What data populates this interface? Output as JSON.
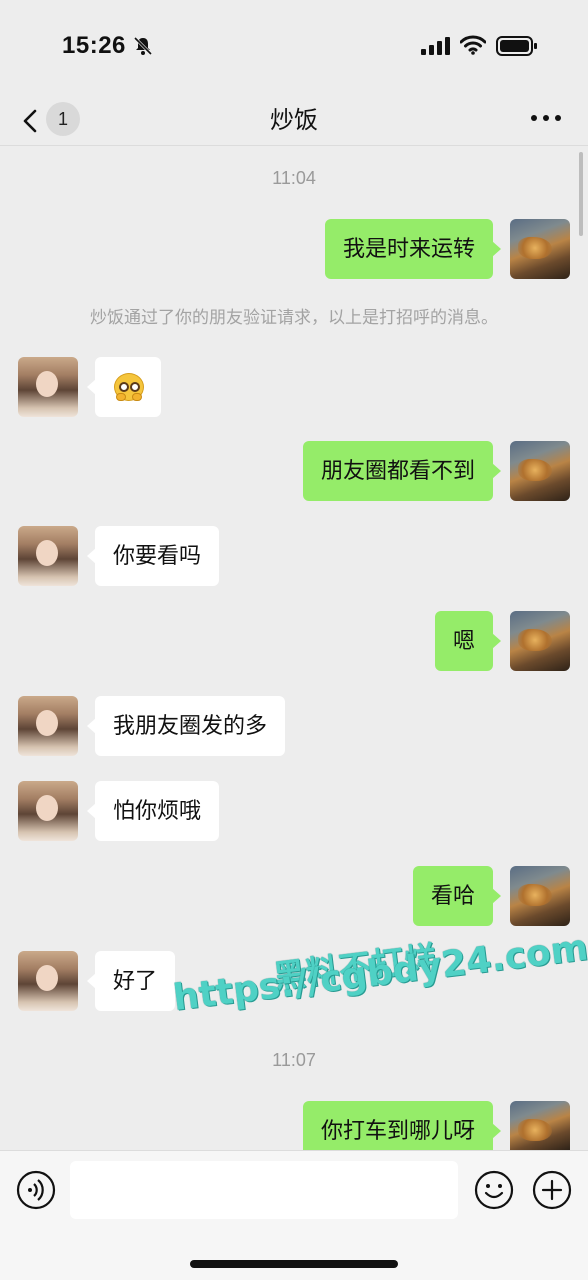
{
  "status_bar": {
    "time": "15:26",
    "icons": [
      "bell-muted-icon",
      "cellular-signal-icon",
      "wifi-icon",
      "battery-icon"
    ]
  },
  "nav": {
    "unread_count": "1",
    "title": "炒饭",
    "back_icon": "chevron-left-icon",
    "more_icon": "more-dots-icon"
  },
  "messages": {
    "time1": "11:04",
    "m1": "我是时来运转",
    "system": "炒饭通过了你的朋友验证请求，以上是打招呼的消息。",
    "m2_emoji": "pleading-face-emoji",
    "m3": "朋友圈都看不到",
    "m4": "你要看吗",
    "m5": "嗯",
    "m6": "我朋友圈发的多",
    "m7": "怕你烦哦",
    "m8": "看哈",
    "m9": "好了",
    "time2": "11:07",
    "m10": "你打车到哪儿呀"
  },
  "watermark": {
    "line1": "黑料不打烊",
    "line2": "https://cgbdy24.com"
  },
  "input_bar": {
    "placeholder": "",
    "icons": [
      "voice-icon",
      "emoji-icon",
      "plus-icon"
    ]
  },
  "colors": {
    "self_bubble": "#95ec69",
    "other_bubble": "#ffffff",
    "background": "#ededed",
    "watermark": "#4fd1c5"
  }
}
